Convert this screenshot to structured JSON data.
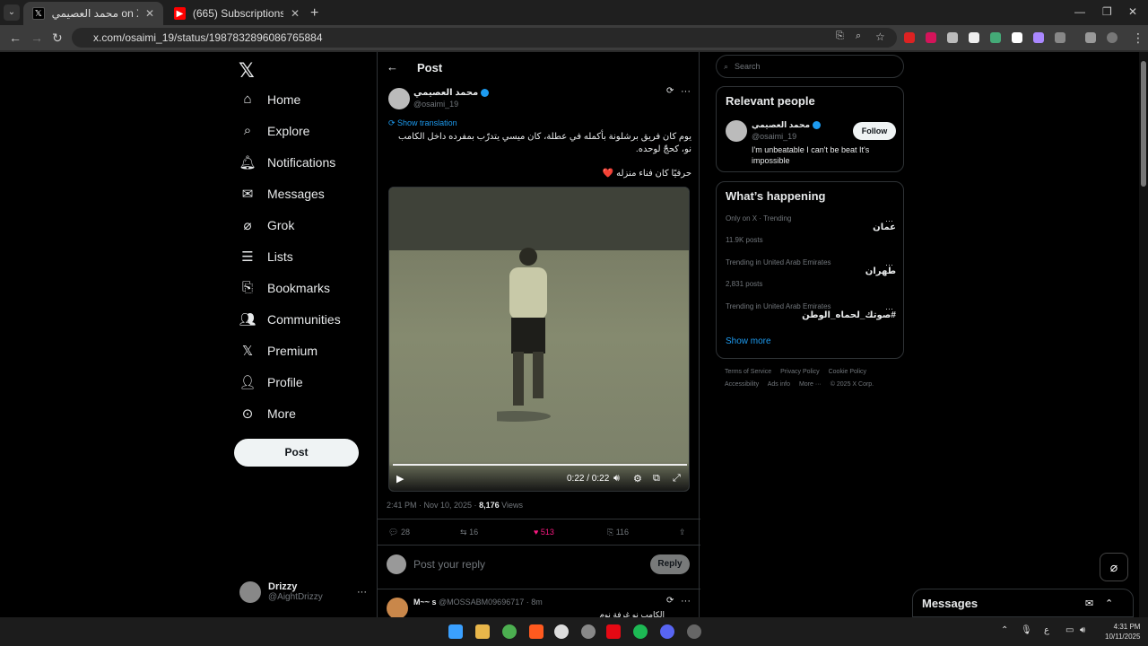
{
  "browser": {
    "tabs": [
      {
        "title": "محمد العصيمي on X: \"يوم كان ف",
        "active": true
      },
      {
        "title": "(665) Subscriptions - YouTube",
        "active": false
      }
    ],
    "url": "x.com/osaimi_19/status/1987832896086765884"
  },
  "nav": {
    "items": [
      "Home",
      "Explore",
      "Notifications",
      "Messages",
      "Grok",
      "Lists",
      "Bookmarks",
      "Communities",
      "Premium",
      "Profile",
      "More"
    ],
    "post_button": "Post",
    "account": {
      "name": "Drizzy",
      "handle": "@AightDrizzy"
    }
  },
  "post": {
    "header": "Post",
    "author": {
      "name": "محمد العصيمي",
      "handle": "@osaimi_19"
    },
    "show_translation": "Show translation",
    "text": "يوم كان فريق برشلونة بأكمله في عطلة، كان ميسي يتدرّب بمفرده داخل الكامب نو، كحجّ لوحده.",
    "text2": "حرفيًا كان فناء منزله ❤️",
    "video": {
      "time": "0:22 / 0:22",
      "progress": 1.0
    },
    "timestamp": "2:41 PM · Nov 10, 2025 ·",
    "views_count": "8,176",
    "views_label": "Views",
    "stats": {
      "replies": "28",
      "reposts": "16",
      "likes": "513",
      "bookmarks": "116"
    },
    "reply_placeholder": "Post your reply",
    "reply_button": "Reply"
  },
  "next_reply": {
    "name": "M~~ s",
    "handle": "@MOSSABM09696717 · 8m",
    "text": "الكامب نو غرفة نوم"
  },
  "sidebar": {
    "search_placeholder": "Search",
    "relevant_title": "Relevant people",
    "person": {
      "name": "محمد العصيمي",
      "handle": "@osaimi_19",
      "bio": "I'm unbeatable I can't be beat It's impossible",
      "follow": "Follow"
    },
    "happening_title": "What’s happening",
    "trends": [
      {
        "context": "Only on X · Trending",
        "topic": "عمان",
        "posts": "11.9K posts"
      },
      {
        "context": "Trending in United Arab Emirates",
        "topic": "طهران",
        "posts": "2,831 posts"
      },
      {
        "context": "Trending in United Arab Emirates",
        "topic": "#صوتك_لحماه_الوطن",
        "posts": ""
      }
    ],
    "show_more": "Show more",
    "footer": [
      "Terms of Service",
      "Privacy Policy",
      "Cookie Policy",
      "Accessibility",
      "Ads info",
      "More ···",
      "© 2025 X Corp."
    ]
  },
  "messages_dock": {
    "title": "Messages"
  },
  "taskbar": {
    "lang": "ع",
    "time": "4:31 PM",
    "date": "10/11/2025"
  },
  "colors": {
    "accent": "#1d9bf0",
    "like": "#f91880",
    "bg": "#000000"
  }
}
